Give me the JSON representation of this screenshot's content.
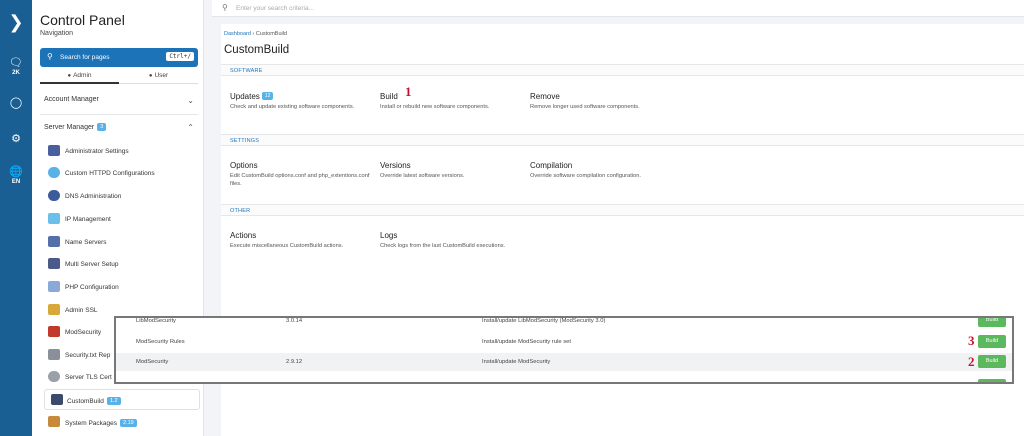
{
  "rail": {
    "items": [
      {
        "icon": "messages-icon",
        "label": "2K"
      },
      {
        "icon": "user-circle-icon",
        "label": ""
      },
      {
        "icon": "gear-icon",
        "label": ""
      },
      {
        "icon": "globe-icon",
        "label": "EN"
      }
    ]
  },
  "sidebar": {
    "title": "Control Panel",
    "subtitle": "Navigation",
    "search_label": "Search for pages",
    "search_shortcut": "Ctrl+/",
    "tabs": [
      {
        "label": "Admin"
      },
      {
        "label": "User"
      }
    ],
    "account_manager": "Account Manager",
    "server_manager": "Server Manager",
    "server_manager_badge": "3",
    "items": [
      {
        "label": "Administrator Settings",
        "icon": "admin-settings-icon",
        "color": "#4a5f9e"
      },
      {
        "label": "Custom HTTPD Configurations",
        "icon": "shield-icon",
        "color": "#58b2e8"
      },
      {
        "label": "DNS Administration",
        "icon": "dns-icon",
        "color": "#3b5b9a"
      },
      {
        "label": "IP Management",
        "icon": "snowflake-icon",
        "color": "#6bc0ea"
      },
      {
        "label": "Name Servers",
        "icon": "server-icon",
        "color": "#5570a8"
      },
      {
        "label": "Multi Server Setup",
        "icon": "multi-server-icon",
        "color": "#4c5a8a"
      },
      {
        "label": "PHP Configuration",
        "icon": "php-icon",
        "color": "#8aa8d8"
      },
      {
        "label": "Admin SSL",
        "icon": "lock-icon",
        "color": "#d9a83a"
      },
      {
        "label": "ModSecurity",
        "icon": "modsecurity-icon",
        "color": "#c0392b"
      },
      {
        "label": "Security.txt Rep",
        "icon": "document-icon",
        "color": "#8a8f99"
      },
      {
        "label": "Server TLS Cert",
        "icon": "certificate-icon",
        "color": "#9aa0a8"
      },
      {
        "label": "CustomBuild",
        "icon": "monitor-icon",
        "color": "#3a4a6b",
        "badge": "1.2"
      },
      {
        "label": "System Packages",
        "icon": "package-icon",
        "color": "#c88a3a",
        "badge": "2.19"
      }
    ]
  },
  "topbar": {
    "placeholder": "Enter your search criteria..."
  },
  "main": {
    "breadcrumb": {
      "root": "Dashboard",
      "current": "CustomBuild"
    },
    "title": "CustomBuild",
    "sections": [
      {
        "label": "SOFTWARE"
      },
      {
        "label": "SETTINGS"
      },
      {
        "label": "OTHER"
      }
    ],
    "cards": {
      "updates": {
        "title": "Updates",
        "badge": "12",
        "desc": "Check and update existing software components."
      },
      "build": {
        "title": "Build",
        "desc": "Install or rebuild new software components."
      },
      "remove": {
        "title": "Remove",
        "desc": "Remove longer used software components."
      },
      "options": {
        "title": "Options",
        "desc": "Edit CustomBuild options.conf and php_extentions.conf files."
      },
      "versions": {
        "title": "Versions",
        "desc": "Override latest software versions."
      },
      "compilation": {
        "title": "Compilation",
        "desc": "Override software compilation configuration."
      },
      "actions": {
        "title": "Actions",
        "desc": "Execute miscellaneous CustomBuild actions."
      },
      "logs": {
        "title": "Logs",
        "desc": "Check logs from the last CustomBuild executions."
      }
    }
  },
  "steps": {
    "one": "1",
    "two": "2",
    "three": "3"
  },
  "overlay": {
    "button_label": "Build",
    "rows": [
      {
        "name": "LibModSecurity",
        "version": "3.0.14",
        "desc": "Install/update LibModSecurity (ModSecurity 3.0)"
      },
      {
        "name": "ModSecurity Rules",
        "version": "",
        "desc": "Install/update ModSecurity rule set"
      },
      {
        "name": "ModSecurity",
        "version": "2.9.12",
        "desc": "Install/update ModSecurity"
      }
    ]
  }
}
